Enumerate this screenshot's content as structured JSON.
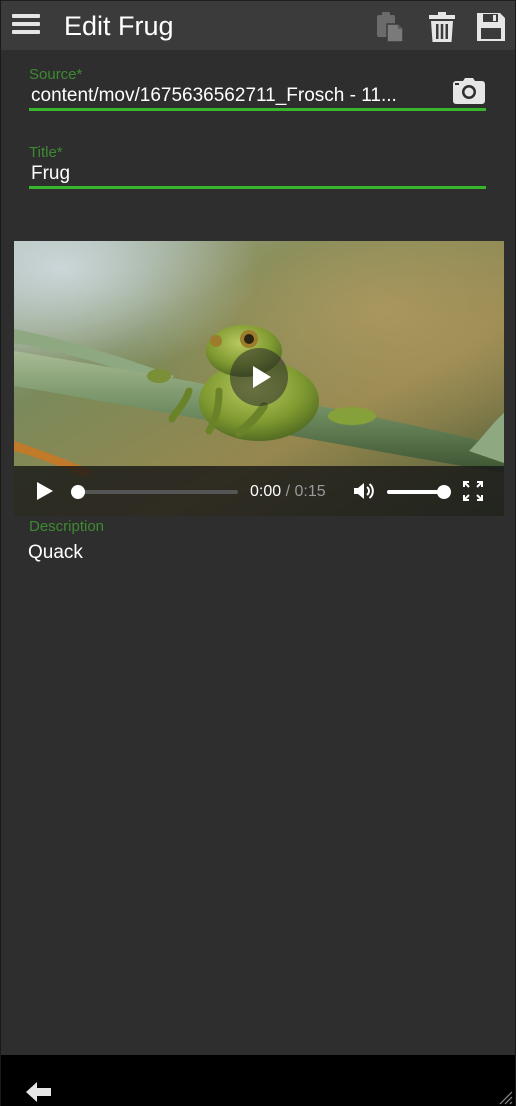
{
  "header": {
    "title": "Edit Frug",
    "menu_icon": "hamburger-menu-icon",
    "actions": [
      {
        "name": "paste-icon",
        "disabled": true
      },
      {
        "name": "trash-icon"
      },
      {
        "name": "save-icon"
      }
    ]
  },
  "form": {
    "source": {
      "label": "Source*",
      "value": "content/mov/1675636562711_Frosch - 11..."
    },
    "title": {
      "label": "Title*",
      "value": "Frug"
    },
    "description": {
      "label": "Description",
      "value": "Quack"
    }
  },
  "video": {
    "current_time": "0:00",
    "separator": " / ",
    "duration": "0:15",
    "progress": 0,
    "volume": 1
  },
  "colors": {
    "accent": "#37b52c",
    "label": "#3e8a32",
    "background": "#2e2e2e",
    "header": "#3b3b3b"
  }
}
